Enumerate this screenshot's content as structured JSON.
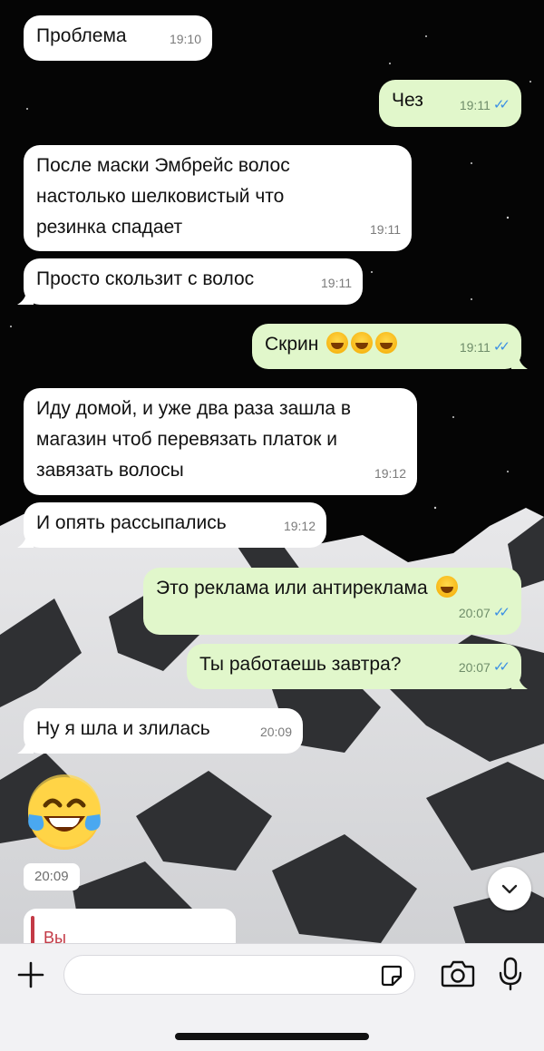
{
  "messages": [
    {
      "id": "m1",
      "text": "Проблема",
      "time": "19:10"
    },
    {
      "id": "m2",
      "text": "Чез",
      "time": "19:11"
    },
    {
      "id": "m3a",
      "text": "После маски Эмбрейс волос"
    },
    {
      "id": "m3b",
      "text": "настолько шелковистый что"
    },
    {
      "id": "m3c",
      "text": "резинка спадает",
      "time": "19:11"
    },
    {
      "id": "m4",
      "text": "Просто скользит с волос",
      "time": "19:11"
    },
    {
      "id": "m5",
      "text": "Скрин",
      "time": "19:11"
    },
    {
      "id": "m6a",
      "text": "Иду домой, и уже два раза зашла в"
    },
    {
      "id": "m6b",
      "text": "магазин чтоб перевязать платок и"
    },
    {
      "id": "m6c",
      "text": "завязать волосы",
      "time": "19:12"
    },
    {
      "id": "m7",
      "text": "И опять рассыпались",
      "time": "19:12"
    },
    {
      "id": "m8",
      "text": "Это реклама или антиреклама",
      "time": "20:07"
    },
    {
      "id": "m9",
      "text": "Ты работаешь завтра?",
      "time": "20:07"
    },
    {
      "id": "m10",
      "text": "Ну я шла и злилась",
      "time": "20:09"
    }
  ],
  "emoji_message": {
    "time": "20:09",
    "icon": "tears-of-joy-emoji"
  },
  "reply_preview": {
    "sender": "Вы"
  },
  "composer": {
    "placeholder": ""
  },
  "colors": {
    "incoming": "#ffffff",
    "outgoing": "#e1f7cb",
    "ticks": "#3b8fe4",
    "reply_accent": "#c33a46"
  }
}
